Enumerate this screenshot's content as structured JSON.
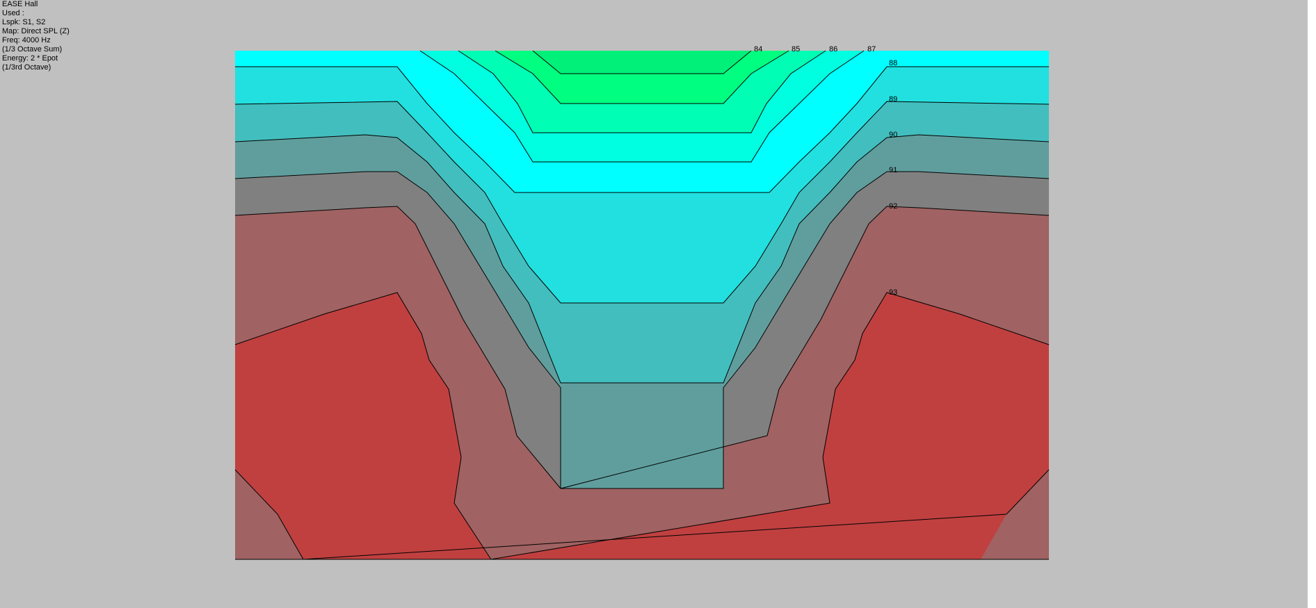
{
  "info": {
    "title": "EASE Hall",
    "used": "Used :",
    "lspk": "Lspk: S1, S2",
    "map": "Map: Direct SPL (Z)",
    "freq": "Freq: 4000 Hz",
    "sum": "(1/3 Octave Sum)",
    "energy": "Energy: 2 * Epot",
    "octave": "(1/3rd Octave)"
  },
  "chart_data": {
    "type": "heatmap",
    "subtype": "contour",
    "contour_levels": [
      "84",
      "85",
      "86",
      "87",
      "88",
      "89",
      "90",
      "91",
      "92",
      "93"
    ],
    "band_colors": [
      "#00ff80",
      "#00ffb4",
      "#00ffe0",
      "#00ffff",
      "#22e0e0",
      "#42bebe",
      "#609e9e",
      "#808080",
      "#a06262",
      "#c04040"
    ]
  }
}
